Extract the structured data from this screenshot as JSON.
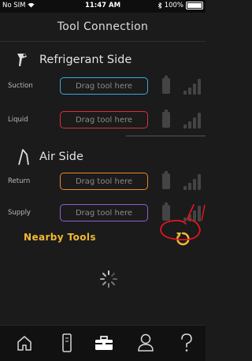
{
  "status_bar": {
    "carrier": "No SIM",
    "time": "11:47 AM",
    "battery": "100%"
  },
  "header": {
    "title": "Tool Connection"
  },
  "refrigerant": {
    "title": "Refrigerant Side",
    "rows": [
      {
        "label": "Suction",
        "placeholder": "Drag tool here",
        "color": "#3aa9d8"
      },
      {
        "label": "Liquid",
        "placeholder": "Drag tool here",
        "color": "#d8323a"
      }
    ]
  },
  "air": {
    "title": "Air Side",
    "rows": [
      {
        "label": "Return",
        "placeholder": "Drag tool here",
        "color": "#e58a2b"
      },
      {
        "label": "Supply",
        "placeholder": "Drag tool here",
        "color": "#9a5ad1"
      }
    ]
  },
  "nearby": {
    "label": "Nearby Tools"
  },
  "tabs": [
    "home-icon",
    "tool-icon",
    "toolbox-icon",
    "user-icon",
    "help-icon"
  ],
  "colors": {
    "accent": "#f2b833",
    "annotation": "#e0161c"
  }
}
